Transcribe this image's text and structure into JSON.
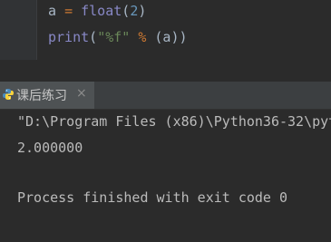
{
  "editor": {
    "line1": {
      "var": "a",
      "op": "=",
      "func": "float",
      "open": "(",
      "arg": "2",
      "close": ")"
    },
    "line2": {
      "func": "print",
      "open": "(",
      "fmt": "\"%f\"",
      "op": "%",
      "args": "(a)",
      "close": ")"
    }
  },
  "run_tab": {
    "label": "课后练习",
    "close_glyph": "×",
    "icon": "python-icon"
  },
  "console": {
    "command_line": "\"D:\\Program Files (x86)\\Python36-32\\pyt",
    "output_line": "2.000000",
    "exit_line": "Process finished with exit code 0"
  },
  "colors": {
    "background": "#2b2b2b",
    "keyword": "#cc7832",
    "number": "#6897bb",
    "string": "#6a8759",
    "builtin": "#8888c6"
  }
}
